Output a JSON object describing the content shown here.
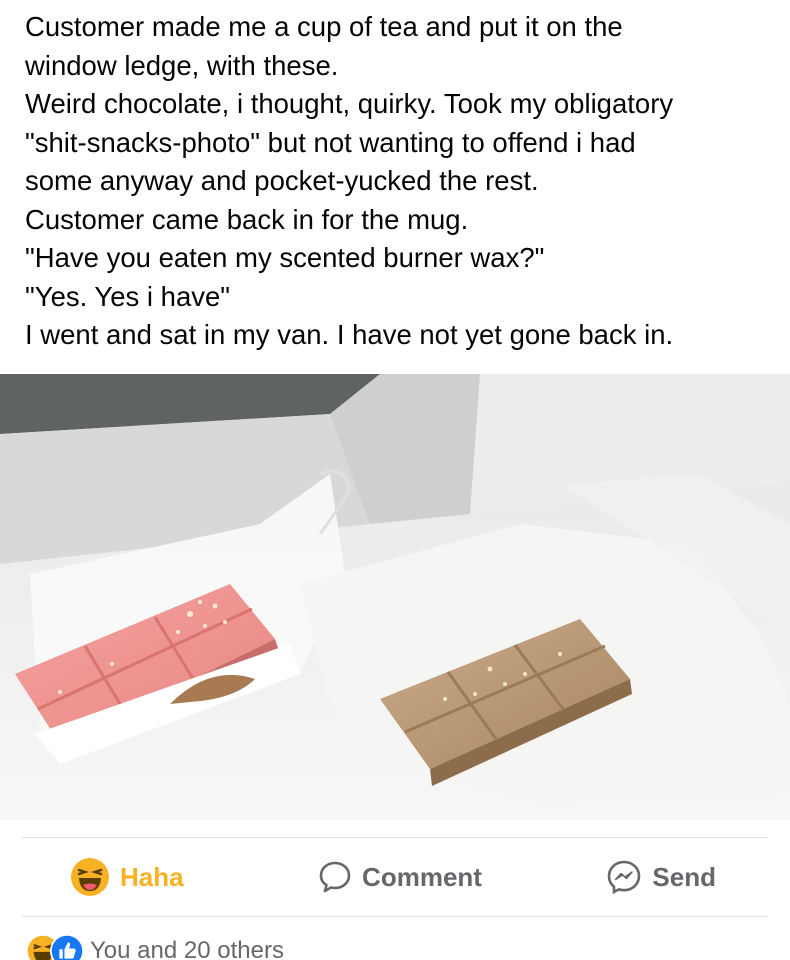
{
  "post": {
    "lines": [
      "Customer made me a cup of tea and put it on the",
      "window ledge, with these.",
      "Weird chocolate, i thought, quirky. Took my obligatory",
      "\"shit-snacks-photo\" but not wanting to offend i had",
      "some anyway and pocket-yucked the rest.",
      "Customer came back in for the mug.",
      "\"Have you eaten my scented burner wax?\"",
      "\"Yes. Yes i have\"",
      "I went and sat in my van. I have not yet gone back in."
    ]
  },
  "actions": {
    "haha_label": "Haha",
    "comment_label": "Comment",
    "send_label": "Send"
  },
  "reactions": {
    "summary": "You and 20 others",
    "icons": [
      "haha-icon",
      "like-icon"
    ]
  },
  "colors": {
    "haha": "#f7b125",
    "muted": "#65676b",
    "like": "#1877f2",
    "divider": "#dddfe2"
  }
}
